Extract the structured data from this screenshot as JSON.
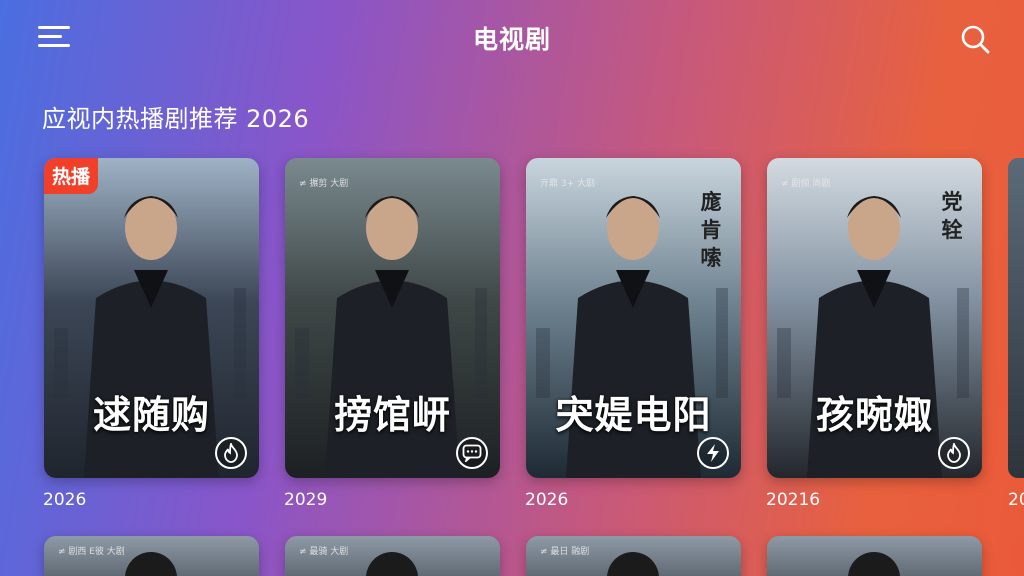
{
  "header": {
    "title": "电视剧",
    "menu_icon": "hamburger-menu-icon",
    "search_icon": "search-icon"
  },
  "section": {
    "title": "应视内热播剧推荐 2026"
  },
  "cards": [
    {
      "title": "逑随购",
      "year": "2026",
      "badge": "热播",
      "studio": "",
      "vertical": "",
      "icon": "flame-icon",
      "bg": [
        "#9fb3c6",
        "#3c4656",
        "#1f252d"
      ]
    },
    {
      "title": "搒馆岍",
      "year": "2029",
      "badge": "",
      "studio": "≠ 搌剪 大剧",
      "vertical": "",
      "icon": "chat-bubble-icon",
      "bg": [
        "#7a8a8f",
        "#3f4747",
        "#1c2022"
      ]
    },
    {
      "title": "宊媞电阳",
      "year": "2026",
      "badge": "",
      "studio": "亓鼎 3+ 大剧",
      "vertical": "庬肯嗦",
      "icon": "lightning-icon",
      "bg": [
        "#c9d5dd",
        "#6f8391",
        "#1e2a34"
      ]
    },
    {
      "title": "孩晼娵",
      "year": "20216",
      "badge": "",
      "studio": "≠ 剧频 尚剧",
      "vertical": "党辁",
      "icon": "flame-icon",
      "bg": [
        "#d3dbe1",
        "#8190a0",
        "#23272c"
      ]
    }
  ],
  "row2": [
    {
      "studio": "≠ 剧西 E彼 大剧"
    },
    {
      "studio": "≠ 最骑 大剧"
    },
    {
      "studio": "≠ 最日 融剧"
    },
    {
      "studio": ""
    }
  ],
  "partial_card": {
    "year": "20"
  }
}
